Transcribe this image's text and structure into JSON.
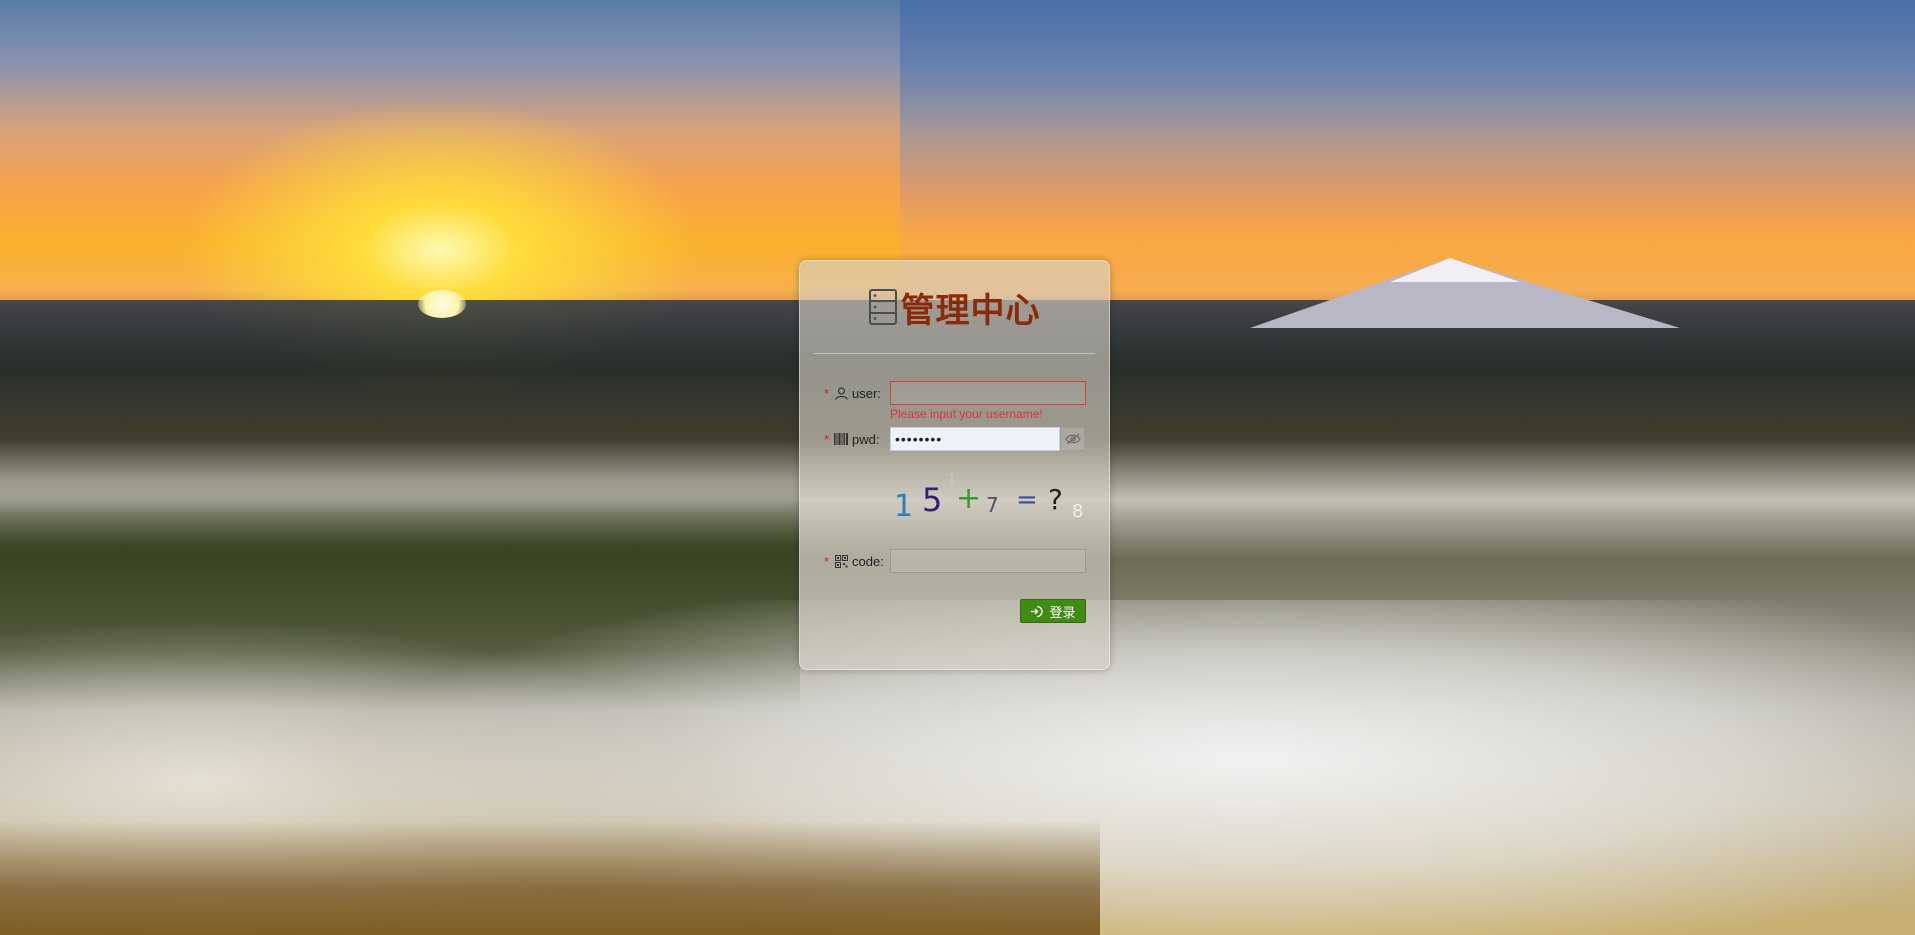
{
  "app": {
    "title": "管理中心",
    "logo_icon": "server-icon"
  },
  "form": {
    "user": {
      "required_mark": "*",
      "label": "user:",
      "icon": "user-icon",
      "value": "",
      "error": "Please input your username!",
      "border_color": "#e83a3a"
    },
    "pwd": {
      "required_mark": "*",
      "label": "pwd:",
      "icon": "barcode-icon",
      "value": "••••••••",
      "toggle_icon": "eye-off-icon"
    },
    "captcha": {
      "tokens": [
        "1",
        "5",
        "+",
        "7",
        "=",
        "?"
      ],
      "noise": [
        "8",
        "1"
      ]
    },
    "code": {
      "required_mark": "*",
      "label": "code:",
      "icon": "qrcode-icon",
      "value": ""
    },
    "submit": {
      "label": "登录",
      "icon": "login-icon",
      "color": "#3f8b13"
    }
  }
}
